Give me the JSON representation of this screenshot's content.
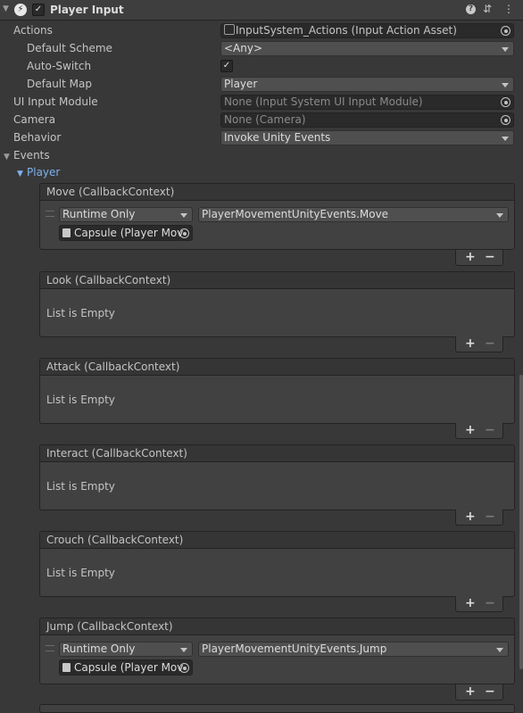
{
  "header": {
    "title": "Player Input",
    "icons": [
      "fold-arrow-icon",
      "player-input-icon",
      "enabled-checkbox",
      "help-icon",
      "preset-icon",
      "more-icon"
    ]
  },
  "fields": {
    "actions_label": "Actions",
    "actions_value": "InputSystem_Actions (Input Action Asset)",
    "default_scheme_label": "Default Scheme",
    "default_scheme_value": "<Any>",
    "auto_switch_label": "Auto-Switch",
    "auto_switch_checked": true,
    "default_map_label": "Default Map",
    "default_map_value": "Player",
    "ui_input_module_label": "UI Input Module",
    "ui_input_module_value": "None (Input System UI Input Module)",
    "camera_label": "Camera",
    "camera_value": "None (Camera)",
    "behavior_label": "Behavior",
    "behavior_value": "Invoke Unity Events"
  },
  "events": {
    "label": "Events",
    "player_label": "Player",
    "empty_text": "List is Empty",
    "list": [
      {
        "title": "Move (CallbackContext)",
        "runtime": "Runtime Only",
        "function": "PlayerMovementUnityEvents.Move",
        "object": "Capsule (Player Mov"
      },
      {
        "title": "Look (CallbackContext)"
      },
      {
        "title": "Attack (CallbackContext)"
      },
      {
        "title": "Interact (CallbackContext)"
      },
      {
        "title": "Crouch (CallbackContext)"
      },
      {
        "title": "Jump (CallbackContext)",
        "runtime": "Runtime Only",
        "function": "PlayerMovementUnityEvents.Jump",
        "object": "Capsule (Player Mov"
      }
    ]
  },
  "buttons": {
    "plus": "+",
    "minus": "−"
  },
  "colors": {
    "background": "#383838",
    "field": "#2a2a2a",
    "dropdown": "#4f4f4f",
    "link": "#7fb2f0"
  }
}
